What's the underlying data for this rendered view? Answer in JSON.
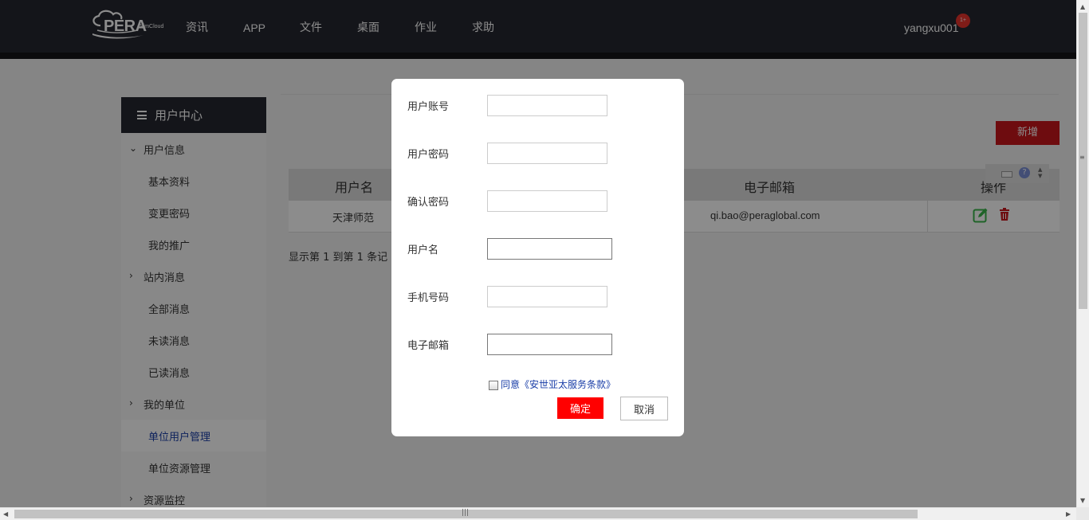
{
  "header": {
    "logo_text": "PERA",
    "logo_sub": "SimCloud",
    "nav": [
      "资讯",
      "APP",
      "文件",
      "桌面",
      "作业",
      "求助"
    ],
    "username": "yangxu001",
    "badge": "1+"
  },
  "sidebar": {
    "title": "用户中心",
    "groups": [
      {
        "label": "用户信息",
        "items": [
          "基本资料",
          "变更密码",
          "我的推广"
        ]
      },
      {
        "label": "站内消息",
        "items": [
          "全部消息",
          "未读消息",
          "已读消息"
        ]
      },
      {
        "label": "我的单位",
        "items": [
          "单位用户管理",
          "单位资源管理"
        ],
        "active": "单位用户管理"
      },
      {
        "label": "资源监控",
        "items": []
      }
    ]
  },
  "main": {
    "add_button": "新增",
    "table": {
      "columns": [
        "用户名",
        "电子邮箱",
        "操作"
      ],
      "rows": [
        {
          "username": "天津师范",
          "email": "qi.bao@peraglobal.com"
        }
      ]
    },
    "footer_info": "显示第 1 到第 1 条记"
  },
  "modal": {
    "fields": [
      {
        "label": "用户账号",
        "value": ""
      },
      {
        "label": "用户密码",
        "value": ""
      },
      {
        "label": "确认密码",
        "value": ""
      },
      {
        "label": "用户名",
        "value": ""
      },
      {
        "label": "手机号码",
        "value": ""
      },
      {
        "label": "电子邮箱",
        "value": ""
      }
    ],
    "agree_text": "同意《安世亚太服务条款》",
    "agree_checked": false,
    "ok_label": "确定",
    "cancel_label": "取消"
  },
  "colors": {
    "header_bg": "#262730",
    "accent_red": "#c8161d",
    "confirm_red": "#ff0000",
    "active_link": "#1b3fa8"
  }
}
